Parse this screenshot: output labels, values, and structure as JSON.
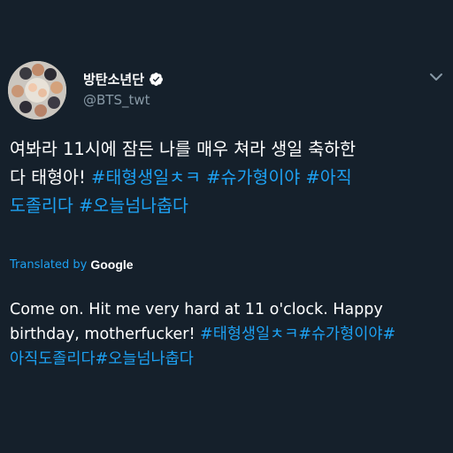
{
  "tweet": {
    "author": {
      "display_name": "방탄소년단",
      "handle": "@BTS_twt",
      "verified_icon": "verified-badge-icon",
      "avatar": "group-photo-avatar"
    },
    "menu_icon": "chevron-down-icon",
    "text": {
      "line1": "여봐라 11시에 잠든 나를 매우 쳐라 생일 축하한",
      "line2_plain": "다 태형아! ",
      "line2_tag1": "#태형생일ㅊㅋ",
      "line2_tag2": "#슈가형이야",
      "line2_tag3": "#아직",
      "line3_tag1": "도졸리다",
      "line3_tag2": "#오늘넘나춥다"
    },
    "translation": {
      "label": "Translated by",
      "provider": "Google",
      "line1": "Come on. Hit me very hard at 11 o'clock. Happy",
      "line2_plain": "birthday, motherfucker! ",
      "line2_tags": "#태형생일ㅊㅋ#슈가형이야#",
      "line3_tags": "아직도졸리다#오늘넘나춥다"
    },
    "colors": {
      "background": "#15202b",
      "link": "#1da1f2",
      "secondary_text": "#8899a6",
      "primary_text": "#ffffff"
    }
  }
}
